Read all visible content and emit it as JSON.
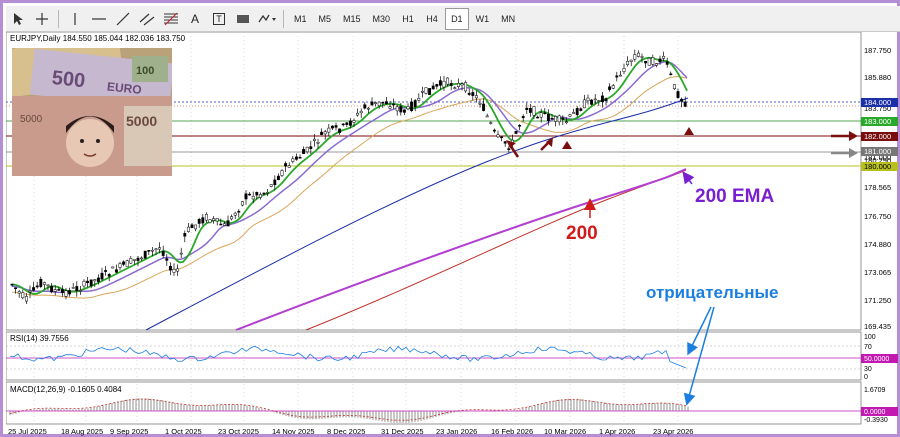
{
  "toolbar": {
    "tools": [
      "cursor-icon",
      "crosshair-icon",
      "vertical-line-icon",
      "horizontal-line-icon",
      "trendline-icon",
      "channel-icon",
      "fibonacci-icon",
      "text-icon",
      "text-label-icon",
      "rectangle-icon",
      "shapes-icon"
    ],
    "text_tool_label": "A",
    "text_label_tool_label": "T",
    "timeframes": [
      "M1",
      "M5",
      "M15",
      "M30",
      "H1",
      "H4",
      "D1",
      "W1",
      "MN"
    ],
    "active_timeframe": "D1"
  },
  "chart": {
    "header": "EURJPY,Daily  184.550 185.044 182.036 183.750",
    "price_axis_labels": [
      "187.750",
      "185.880",
      "183.750",
      "183.000",
      "182.000",
      "181.000",
      "180.290",
      "180.000",
      "178.565",
      "176.750",
      "174.880",
      "173.065",
      "171.250",
      "169.435"
    ],
    "current_price_tag": "184.000",
    "level_tags": {
      "l183": "183.000",
      "l182": "182.000",
      "l181": "181.000",
      "l180": "180.000"
    },
    "date_labels": [
      "25 Jul 2025",
      "18 Aug 2025",
      "9 Sep 2025",
      "1 Oct 2025",
      "23 Oct 2025",
      "14 Nov 2025",
      "8 Dec 2025",
      "31 Dec 2025",
      "23 Jan 2026",
      "16 Feb 2026",
      "10 Mar 2026",
      "1 Apr 2026",
      "23 Apr 2026"
    ],
    "annotation_ema": "200 EMA",
    "annotation_200": "200",
    "annotation_negative": "отрицательные",
    "colors": {
      "ema200": "#b23fd0",
      "sma200": "#c0302a",
      "ma_blue": "#1b2fa8",
      "ma_green": "#2aa82a",
      "ma_tan": "#d9a55a",
      "ma_violet": "#8a6bd0",
      "arrow_dark_red": "#7a0d0d",
      "annotation_purple": "#7a1fd0",
      "annotation_red": "#d01b1b",
      "annotation_blue": "#1c7fe0"
    }
  },
  "rsi": {
    "header": "RSI(14) 39.7556",
    "axis_labels": [
      "100",
      "70",
      "50.0000",
      "30",
      "0"
    ]
  },
  "macd": {
    "header": "MACD(12,26,9) -0.1605 0.4084",
    "axis_labels": [
      "1.6709",
      "0.0000",
      "-0.3930"
    ]
  }
}
